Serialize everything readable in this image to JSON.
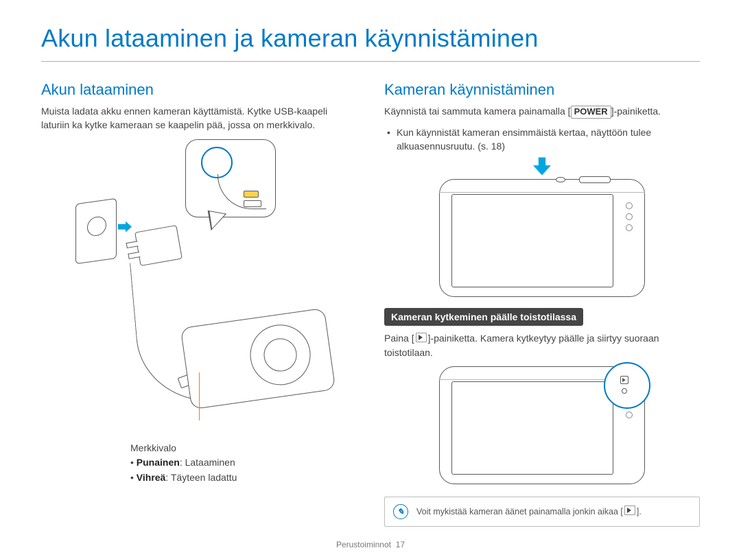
{
  "page_title": "Akun lataaminen ja kameran käynnistäminen",
  "left": {
    "heading": "Akun lataaminen",
    "intro": "Muista ladata akku ennen kameran käyttämistä. Kytke USB-kaapeli laturiin ka kytke kameraan se kaapelin pää, jossa on merkkivalo.",
    "caption_label": "Merkkivalo",
    "caption_red_key": "Punainen",
    "caption_red_rest": ": Lataaminen",
    "caption_green_key": "Vihreä",
    "caption_green_rest": ": Täyteen ladattu"
  },
  "right": {
    "heading": "Kameran käynnistäminen",
    "intro_pre": "Käynnistä tai sammuta kamera painamalla [",
    "power_label": "POWER",
    "intro_post": "]-painiketta.",
    "bullet1": "Kun käynnistät kameran ensimmäistä kertaa, näyttöön tulee alkuasennusruutu. (s. 18)",
    "sub_pill": "Kameran kytkeminen päälle toistotilassa",
    "sub_text_pre": "Paina [",
    "sub_text_post": "]-painiketta. Kamera kytkeytyy päälle ja siirtyy suoraan toistotilaan.",
    "note_pre": "Voit mykistää kameran äänet painamalla jonkin aikaa [",
    "note_post": "]."
  },
  "footer_label": "Perustoiminnot",
  "footer_page": "17"
}
